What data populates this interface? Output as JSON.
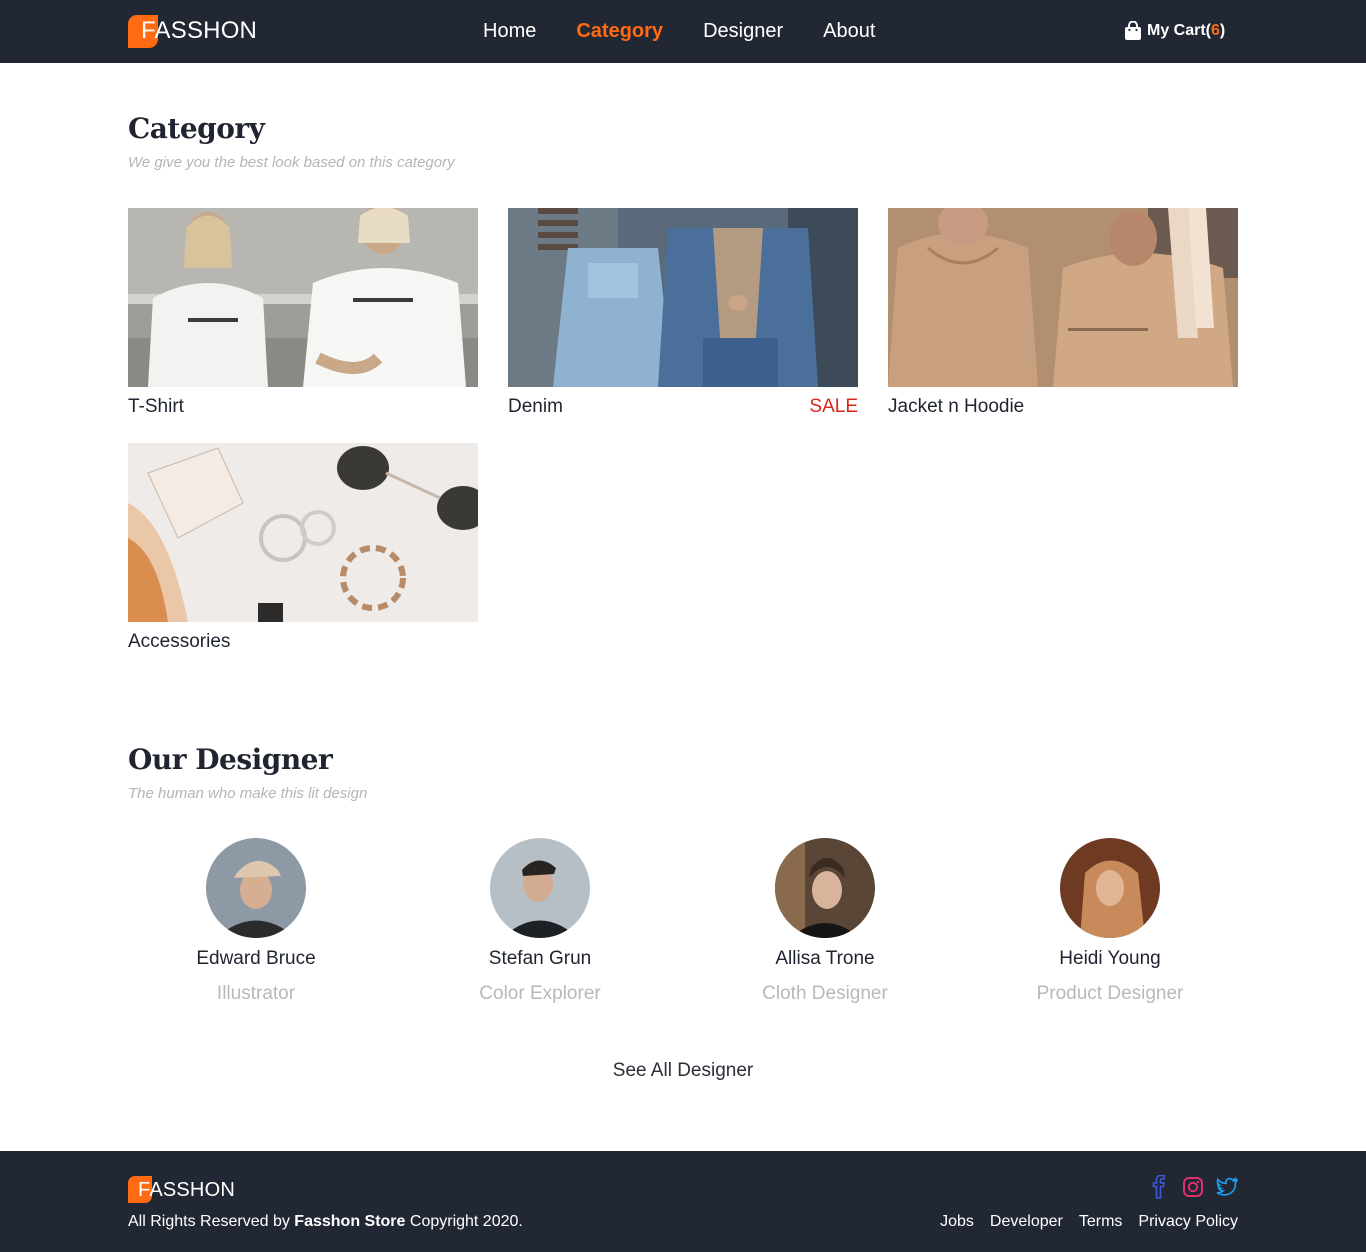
{
  "brand": {
    "name": "FASSHON",
    "accent": "#ff6a13",
    "dark": "#212733"
  },
  "nav": {
    "items": [
      {
        "label": "Home",
        "active": false
      },
      {
        "label": "Category",
        "active": true
      },
      {
        "label": "Designer",
        "active": false
      },
      {
        "label": "About",
        "active": false
      }
    ],
    "cart": {
      "icon": "shopping-bag-icon",
      "label": "My Cart(",
      "count": "6",
      "suffix": ")"
    }
  },
  "category_section": {
    "title": "Category",
    "subtitle": "We give you the best look based on this category",
    "items": [
      {
        "label": "T-Shirt",
        "badge": ""
      },
      {
        "label": "Denim",
        "badge": "SALE"
      },
      {
        "label": "Jacket n Hoodie",
        "badge": ""
      },
      {
        "label": "Accessories",
        "badge": ""
      }
    ]
  },
  "designer_section": {
    "title": "Our Designer",
    "subtitle": "The human who make this lit design",
    "designers": [
      {
        "name": "Edward Bruce",
        "role": "Illustrator"
      },
      {
        "name": "Stefan Grun",
        "role": "Color Explorer"
      },
      {
        "name": "Allisa Trone",
        "role": "Cloth Designer"
      },
      {
        "name": "Heidi Young",
        "role": "Product Designer"
      }
    ],
    "see_all": "See All Designer"
  },
  "footer": {
    "brand": "FASSHON",
    "copyright_prefix": "All Rights Reserved by ",
    "copyright_store": "Fasshon Store",
    "copyright_suffix": " Copyright 2020.",
    "socials": [
      "facebook-icon",
      "instagram-icon",
      "twitter-icon"
    ],
    "links": [
      "Jobs",
      "Developer",
      "Terms",
      "Privacy Policy"
    ]
  }
}
